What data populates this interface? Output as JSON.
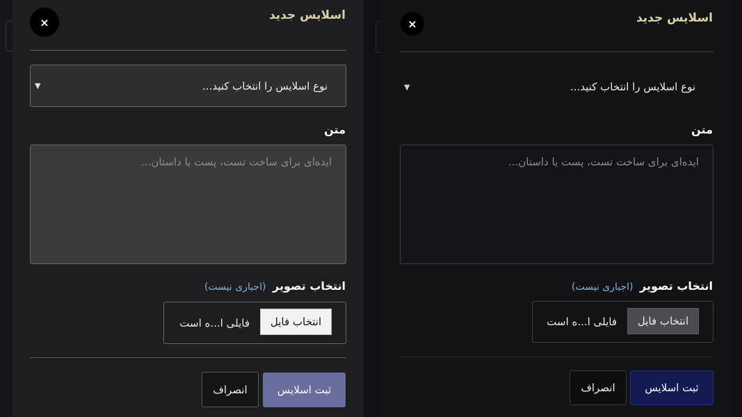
{
  "modal": {
    "title": "اسلایس جدید",
    "close_glyph": "×",
    "type_select": {
      "value": "نوع اسلایس را انتخاب کنید...",
      "arrow": "▼"
    },
    "text_label": "متن",
    "text_placeholder": "ایده‌ای برای ساخت تست، پست یا داستان...",
    "image_label": "انتخاب تصویر",
    "image_optional": "(اجباری نیست)",
    "file_button": "انتخاب فایل",
    "file_status": "فایلی ا...ه است",
    "submit_button": "ثبت اسلایس",
    "cancel_button": "انصراف"
  },
  "colors": {
    "title": "#d8d2a6",
    "optional": "#7fb3e6",
    "submit_a": "#6a6e9e",
    "submit_b": "#141a52"
  }
}
